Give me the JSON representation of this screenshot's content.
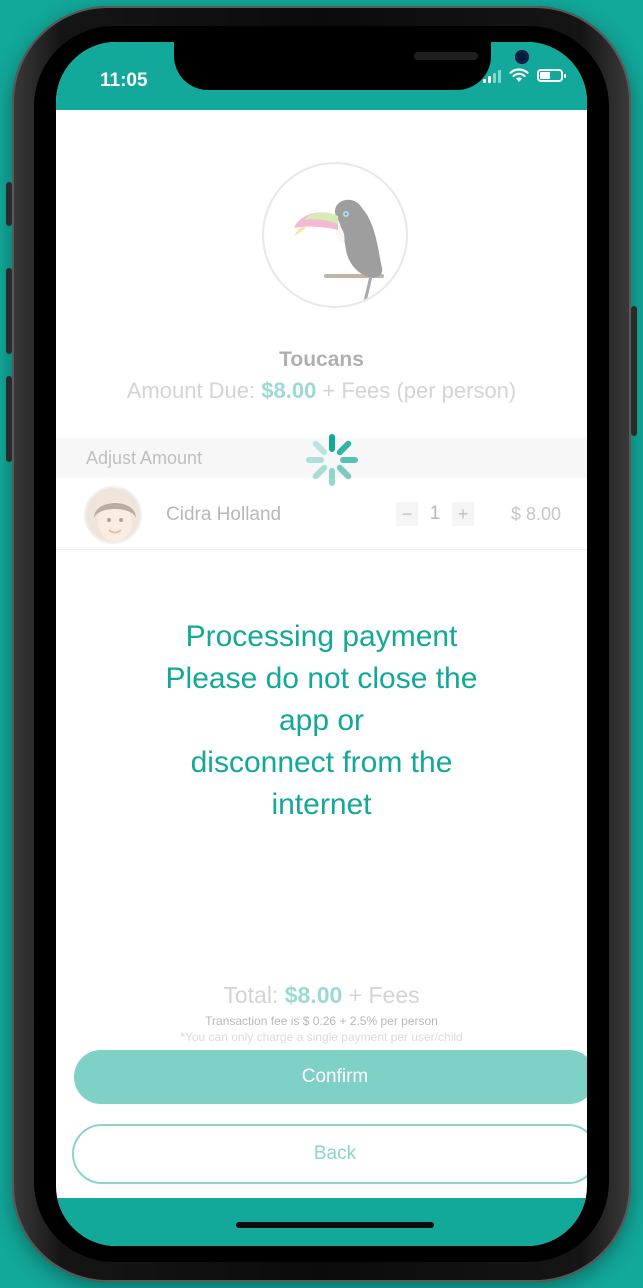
{
  "status_bar": {
    "time": "11:05"
  },
  "group": {
    "name": "Toucans"
  },
  "amount_due": {
    "prefix": "Amount Due: ",
    "value": "$8.00",
    "suffix": " + Fees (per person)"
  },
  "adjust": {
    "label": "Adjust Amount"
  },
  "member": {
    "name": "Cidra Holland",
    "quantity": "1",
    "minus": "−",
    "plus": "+",
    "price": "$ 8.00"
  },
  "processing_message": [
    "Processing payment",
    "Please do not close the",
    "app or",
    "disconnect from the",
    "internet"
  ],
  "total": {
    "prefix": "Total: ",
    "value": "$8.00",
    "suffix": " + Fees"
  },
  "fee_note": "Transaction fee is $ 0.26 + 2.5% per person",
  "single_payment_note": "*You can only charge a single payment per user/child",
  "buttons": {
    "confirm": "Confirm",
    "back": "Back"
  },
  "colors": {
    "accent": "#12a89a",
    "confirm_bg": "#7fd0c6",
    "back_border": "#8ad4cb"
  }
}
